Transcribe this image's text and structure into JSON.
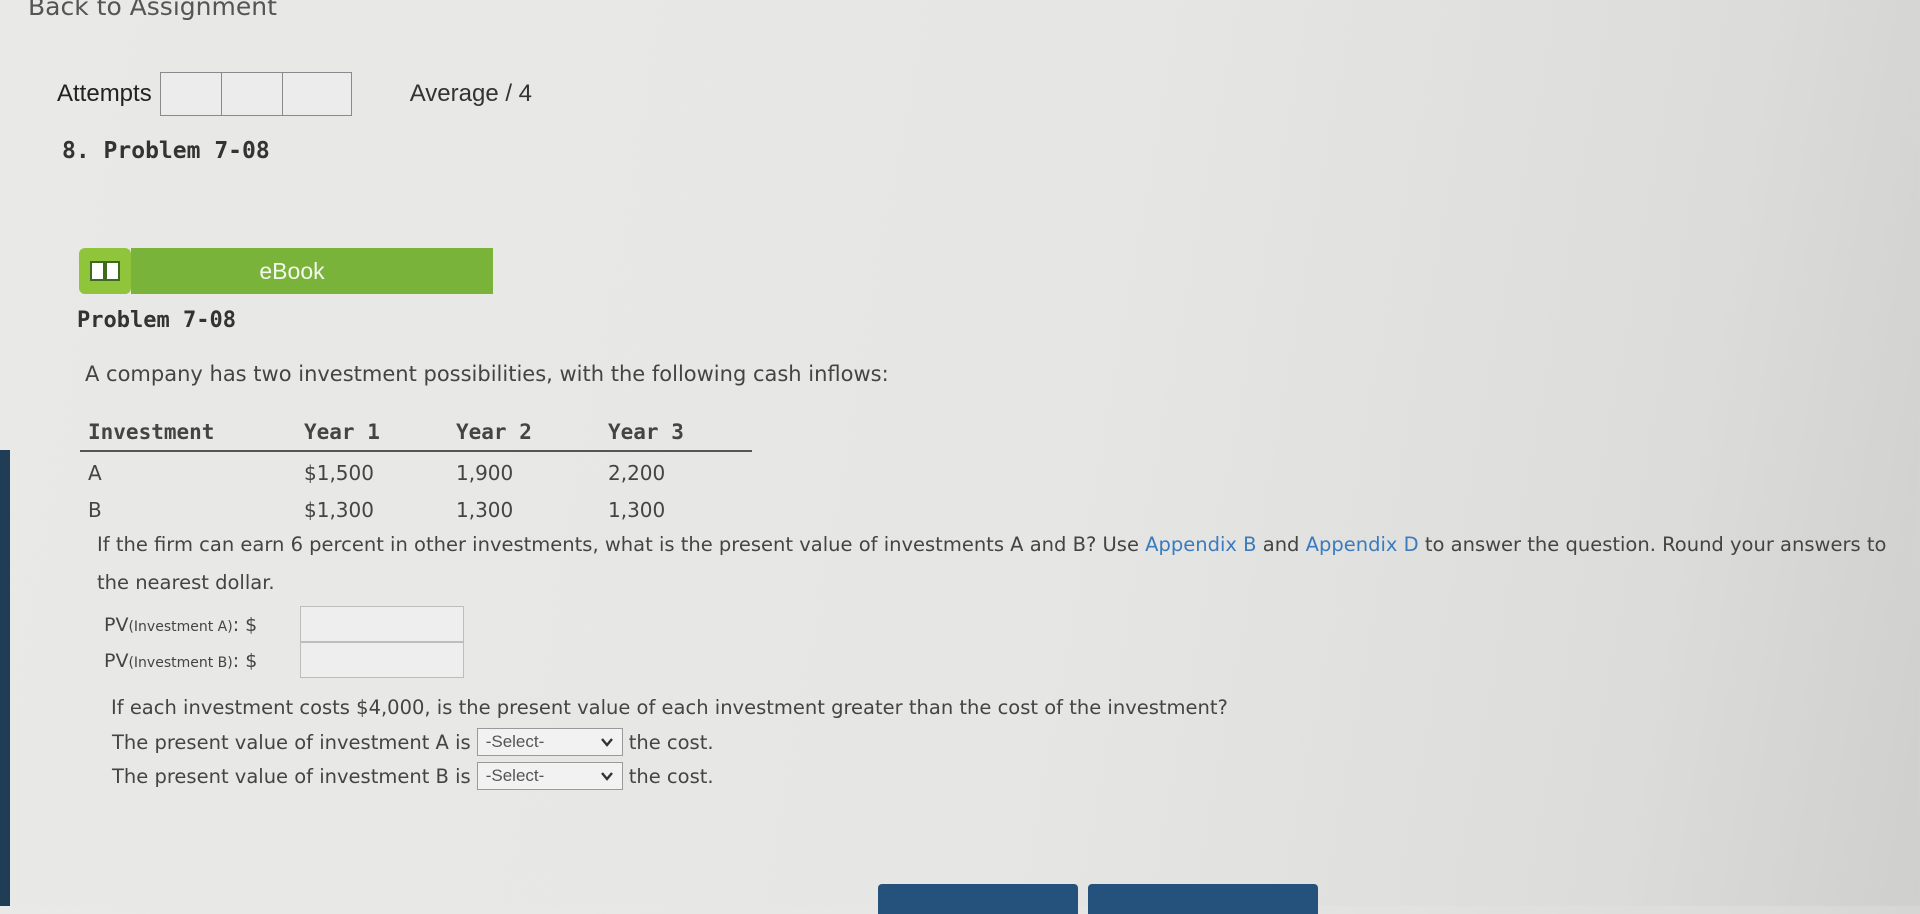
{
  "nav": {
    "back_label": "Back to Assignment"
  },
  "attempts": {
    "label": "Attempts",
    "average": "Average / 4"
  },
  "problem": {
    "title": "8.  Problem 7-08",
    "ebook_label": "eBook",
    "subtitle": "Problem 7-08",
    "intro": "A company has two investment possibilities, with the following cash inflows:"
  },
  "table": {
    "headers": [
      "Investment",
      "Year 1",
      "Year 2",
      "Year 3"
    ],
    "rows": [
      [
        "A",
        "$1,500",
        "1,900",
        "2,200"
      ],
      [
        "B",
        "$1,300",
        "1,300",
        "1,300"
      ]
    ]
  },
  "question": {
    "text_before": "If the firm can earn 6 percent in other investments, what is the present value of investments A and B? Use ",
    "link1": "Appendix B",
    "text_mid": " and ",
    "link2": "Appendix D",
    "text_after": " to answer the question. Round your answers to the nearest dollar."
  },
  "pv": {
    "a_prefix": "PV",
    "a_sub": "(Investment A)",
    "a_suffix": ": $",
    "b_prefix": "PV",
    "b_sub": "(Investment B)",
    "b_suffix": ": $"
  },
  "question2": {
    "text": "If each investment costs $4,000, is the present value of each investment greater than the cost of the investment?",
    "row_a_before": "The present value of investment A is",
    "row_b_before": "The present value of investment B is",
    "select_placeholder": "-Select-",
    "after": "the cost."
  },
  "colors": {
    "ebook_green": "#7ab33a",
    "link_blue": "#3a7bbf",
    "button_blue": "#24527d"
  }
}
